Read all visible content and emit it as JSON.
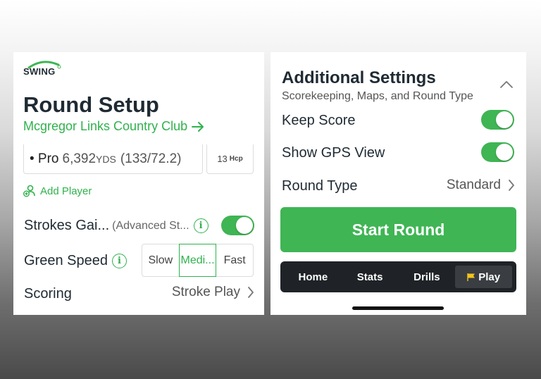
{
  "app": {
    "logo_text": "SWING"
  },
  "round_setup": {
    "title": "Round Setup",
    "course_name": "Mcgregor Links Country Club",
    "tee": {
      "name": "• Pro",
      "yards": "6,392",
      "yards_unit": "YDS",
      "rating": "(133/72.2)"
    },
    "handicap": {
      "value": "13",
      "label": "Hcp"
    },
    "add_player_label": "Add Player",
    "strokes_gained": {
      "label": "Strokes Gai...",
      "sublabel": "(Advanced St...",
      "enabled": true
    },
    "green_speed": {
      "label": "Green Speed",
      "options": [
        "Slow",
        "Medi...",
        "Fast"
      ],
      "selected": "Medi..."
    },
    "scoring": {
      "label": "Scoring",
      "value": "Stroke Play"
    }
  },
  "additional_settings": {
    "title": "Additional Settings",
    "subtitle": "Scorekeeping, Maps, and Round Type",
    "keep_score": {
      "label": "Keep Score",
      "enabled": true
    },
    "show_gps": {
      "label": "Show GPS View",
      "enabled": true
    },
    "round_type": {
      "label": "Round Type",
      "value": "Standard"
    },
    "start_button": "Start Round"
  },
  "tabbar": {
    "tabs": [
      {
        "label": "Home",
        "active": false
      },
      {
        "label": "Stats",
        "active": false
      },
      {
        "label": "Drills",
        "active": false
      },
      {
        "label": "Play",
        "active": true
      }
    ]
  },
  "colors": {
    "accent": "#3fb554",
    "text_dark": "#1f2a33",
    "tabbar_bg": "#1f2327",
    "flag": "#f5c518"
  }
}
